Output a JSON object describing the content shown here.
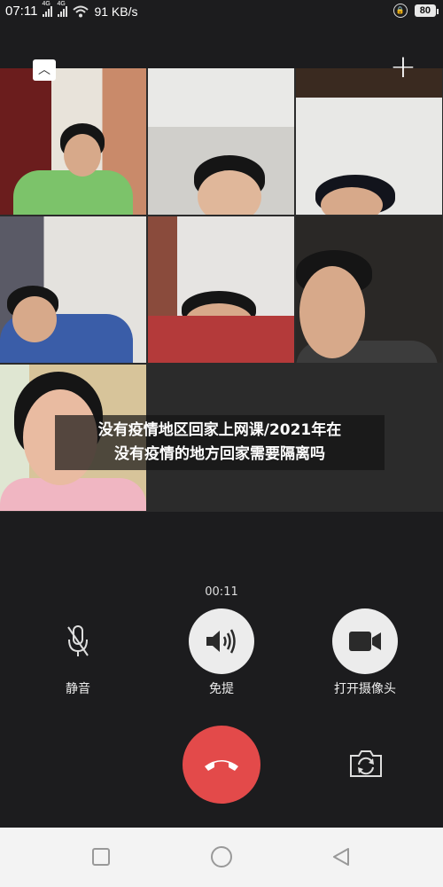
{
  "status_bar": {
    "time": "07:11",
    "signal1_label": "4G",
    "signal2_label": "4G",
    "net_speed": "91 KB/s",
    "battery": "80"
  },
  "video_grid": {
    "tiles": [
      {
        "name": "participant-1"
      },
      {
        "name": "participant-2"
      },
      {
        "name": "participant-3"
      },
      {
        "name": "participant-4"
      },
      {
        "name": "participant-5"
      },
      {
        "name": "participant-6"
      },
      {
        "name": "participant-7"
      }
    ]
  },
  "caption": {
    "line1": "没有疫情地区回家上网课/2021年在",
    "line2": "没有疫情的地方回家需要隔离吗"
  },
  "call": {
    "timer": "00:11",
    "mute_label": "静音",
    "speaker_label": "免提",
    "camera_label": "打开摄像头"
  },
  "icons": {
    "collapse": "chevron-up-icon",
    "add": "plus-icon",
    "mute": "microphone-icon",
    "speaker": "speaker-icon",
    "camera": "video-camera-icon",
    "hangup": "phone-hangup-icon",
    "flip": "camera-flip-icon"
  },
  "colors": {
    "background": "#1c1c1e",
    "hangup": "#e34a4a",
    "control_circle": "#ececec"
  }
}
